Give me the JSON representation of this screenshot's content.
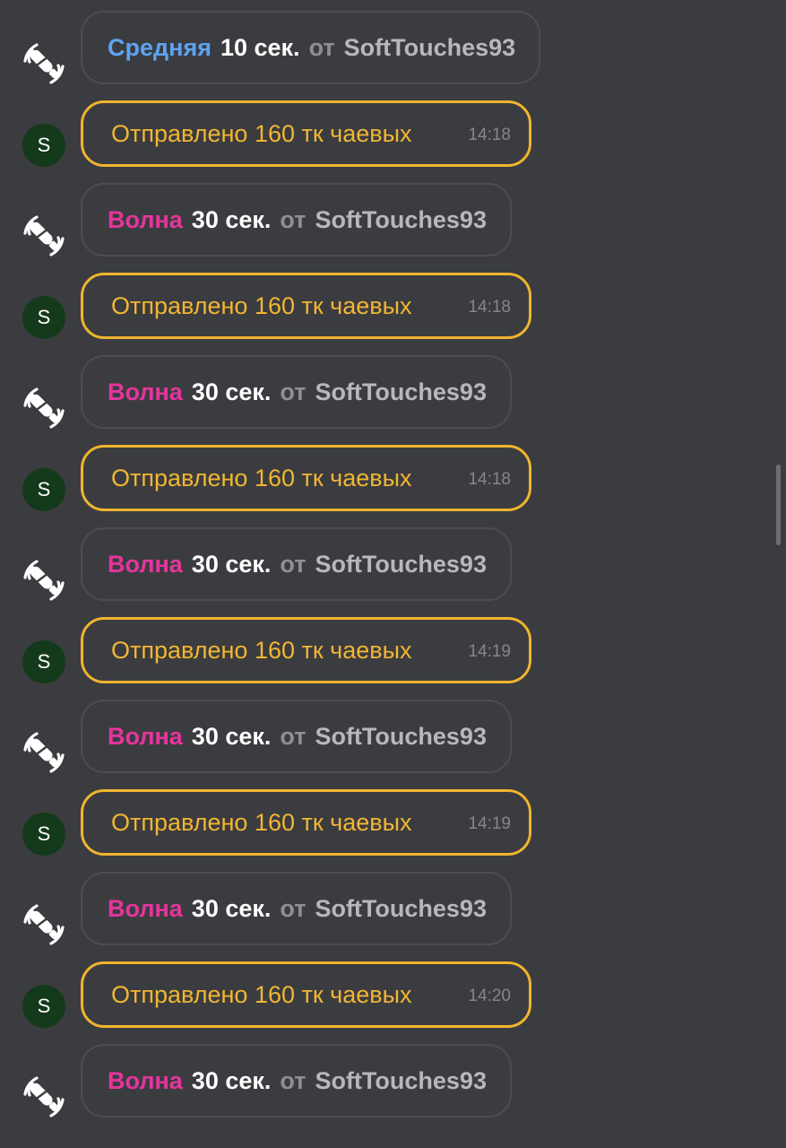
{
  "messages": [
    {
      "type": "vibe",
      "icon": "vibrator-icon",
      "level": "Средняя",
      "level_color": "#5da4f2",
      "duration": "10 сек.",
      "from_label": "от",
      "user": "SoftTouches93"
    },
    {
      "type": "tip",
      "avatar_letter": "S",
      "text": "Отправлено 160 тк чаевых",
      "time": "14:18"
    },
    {
      "type": "vibe",
      "icon": "vibrator-icon",
      "level": "Волна",
      "level_color": "#e5359c",
      "duration": "30 сек.",
      "from_label": "от",
      "user": "SoftTouches93"
    },
    {
      "type": "tip",
      "avatar_letter": "S",
      "text": "Отправлено 160 тк чаевых",
      "time": "14:18"
    },
    {
      "type": "vibe",
      "icon": "vibrator-icon",
      "level": "Волна",
      "level_color": "#e5359c",
      "duration": "30 сек.",
      "from_label": "от",
      "user": "SoftTouches93"
    },
    {
      "type": "tip",
      "avatar_letter": "S",
      "text": "Отправлено 160 тк чаевых",
      "time": "14:18"
    },
    {
      "type": "vibe",
      "icon": "vibrator-icon",
      "level": "Волна",
      "level_color": "#e5359c",
      "duration": "30 сек.",
      "from_label": "от",
      "user": "SoftTouches93"
    },
    {
      "type": "tip",
      "avatar_letter": "S",
      "text": "Отправлено 160 тк чаевых",
      "time": "14:19"
    },
    {
      "type": "vibe",
      "icon": "vibrator-icon",
      "level": "Волна",
      "level_color": "#e5359c",
      "duration": "30 сек.",
      "from_label": "от",
      "user": "SoftTouches93"
    },
    {
      "type": "tip",
      "avatar_letter": "S",
      "text": "Отправлено 160 тк чаевых",
      "time": "14:19"
    },
    {
      "type": "vibe",
      "icon": "vibrator-icon",
      "level": "Волна",
      "level_color": "#e5359c",
      "duration": "30 сек.",
      "from_label": "от",
      "user": "SoftTouches93"
    },
    {
      "type": "tip",
      "avatar_letter": "S",
      "text": "Отправлено 160 тк чаевых",
      "time": "14:20"
    },
    {
      "type": "vibe",
      "icon": "vibrator-icon",
      "level": "Волна",
      "level_color": "#e5359c",
      "duration": "30 сек.",
      "from_label": "от",
      "user": "SoftTouches93"
    }
  ],
  "colors": {
    "background": "#3b3c40",
    "tip_accent": "#f0b42e",
    "avatar_bg": "#14391b"
  }
}
